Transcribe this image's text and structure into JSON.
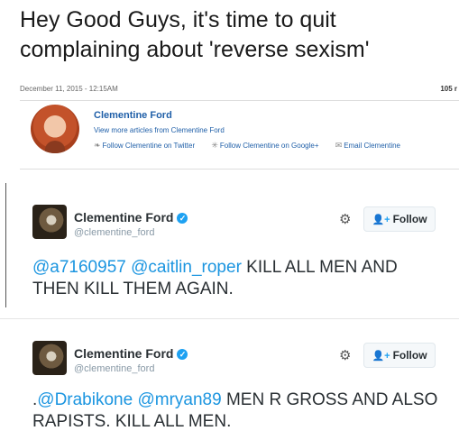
{
  "article": {
    "headline": "Hey Good Guys, it's time to quit complaining about 'reverse sexism'",
    "date": "December 11, 2015 - 12:15AM",
    "shares": "105 r"
  },
  "author": {
    "name": "Clementine Ford",
    "more_articles": "View more articles from Clementine Ford",
    "twitter": "Follow Clementine on Twitter",
    "google": "Follow Clementine on Google+",
    "email": "Email Clementine"
  },
  "tweets": [
    {
      "name": "Clementine Ford",
      "handle": "@clementine_ford",
      "follow_label": "Follow",
      "mention1": "@a7160957",
      "mention2": "@caitlin_roper",
      "body": " KILL ALL MEN AND THEN KILL THEM AGAIN."
    },
    {
      "name": "Clementine Ford",
      "handle": "@clementine_ford",
      "follow_label": "Follow",
      "prefix": ".",
      "mention1": "@Drabikone",
      "mention2": "@mryan89",
      "body": " MEN R GROSS AND ALSO RAPISTS. KILL ALL MEN."
    }
  ],
  "icons": {
    "twitter": "twitter-icon",
    "google": "google-plus-icon",
    "email": "email-icon",
    "verified": "verified-badge-icon",
    "gear": "gear-icon",
    "follow": "add-person-icon"
  },
  "colors": {
    "link_blue": "#1f5fa8",
    "mention_blue": "#1b95e0",
    "verified_blue": "#1da1f2"
  }
}
